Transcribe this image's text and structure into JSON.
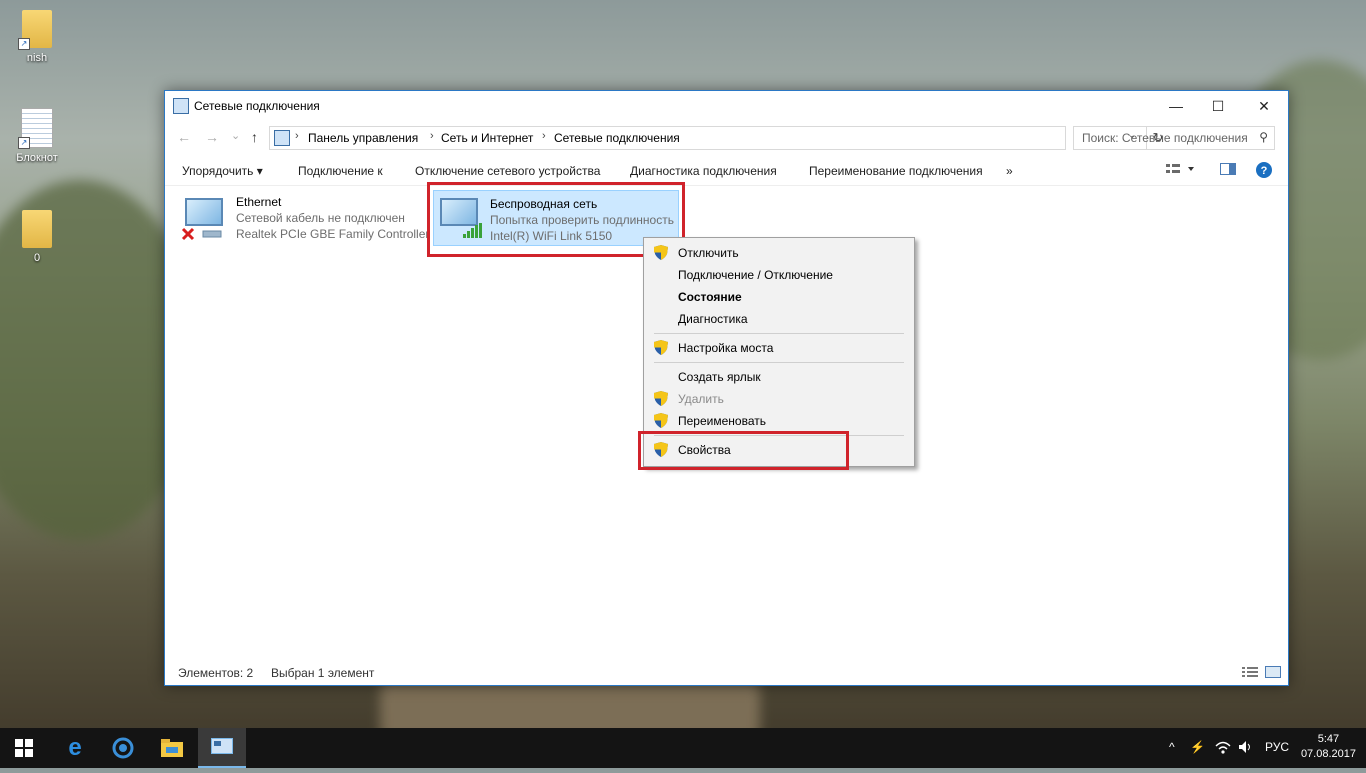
{
  "desktop": {
    "icons": [
      {
        "label": "nish",
        "icon": "folder-icon"
      },
      {
        "label": "Блокнот",
        "icon": "notepad-icon"
      },
      {
        "label": "0",
        "icon": "folder-icon"
      }
    ]
  },
  "window": {
    "title": "Сетевые подключения",
    "controls": {
      "minimize": "—",
      "maximize": "☐",
      "close": "✕"
    }
  },
  "address": {
    "back": "←",
    "forward": "→",
    "recent": "⌄",
    "up": "↑",
    "crumbs": [
      "Панель управления",
      "Сеть и Интернет",
      "Сетевые подключения"
    ],
    "separator": "›",
    "dropdown": "⌄",
    "refresh": "↻",
    "search_placeholder": "Поиск: Сетевые подключения"
  },
  "toolbar": {
    "organize": "Упорядочить ▾",
    "connect_to": "Подключение к",
    "disable_device": "Отключение сетевого устройства",
    "diagnose": "Диагностика подключения",
    "rename": "Переименование подключения",
    "more": "»"
  },
  "connections": [
    {
      "name": "Ethernet",
      "status": "Сетевой кабель не подключен",
      "device": "Realtek PCIe GBE Family Controller",
      "icon": "ethernet-adapter-icon"
    },
    {
      "name": "Беспроводная сеть",
      "status": "Попытка проверить подлинность",
      "device": "Intel(R) WiFi Link 5150",
      "icon": "wireless-adapter-icon",
      "selected": true
    }
  ],
  "context_menu": [
    {
      "label": "Отключить",
      "shield": true
    },
    {
      "label": "Подключение / Отключение",
      "shield": false
    },
    {
      "label": "Состояние",
      "shield": false,
      "bold": true
    },
    {
      "label": "Диагностика",
      "shield": false
    },
    {
      "label": "Настройка моста",
      "shield": true
    },
    {
      "label": "Создать ярлык",
      "shield": false
    },
    {
      "label": "Удалить",
      "shield": true,
      "disabled": true
    },
    {
      "label": "Переименовать",
      "shield": true
    },
    {
      "label": "Свойства",
      "shield": true
    }
  ],
  "statusbar": {
    "items_count": "Элементов: 2",
    "selected": "Выбран 1 элемент"
  },
  "taskbar": {
    "language": "РУС",
    "time": "5:47",
    "date": "07.08.2017",
    "tray_chevron": "^"
  },
  "colors": {
    "highlight": "#d0232b",
    "selection": "#cce8ff",
    "accent": "#2b78c5"
  }
}
